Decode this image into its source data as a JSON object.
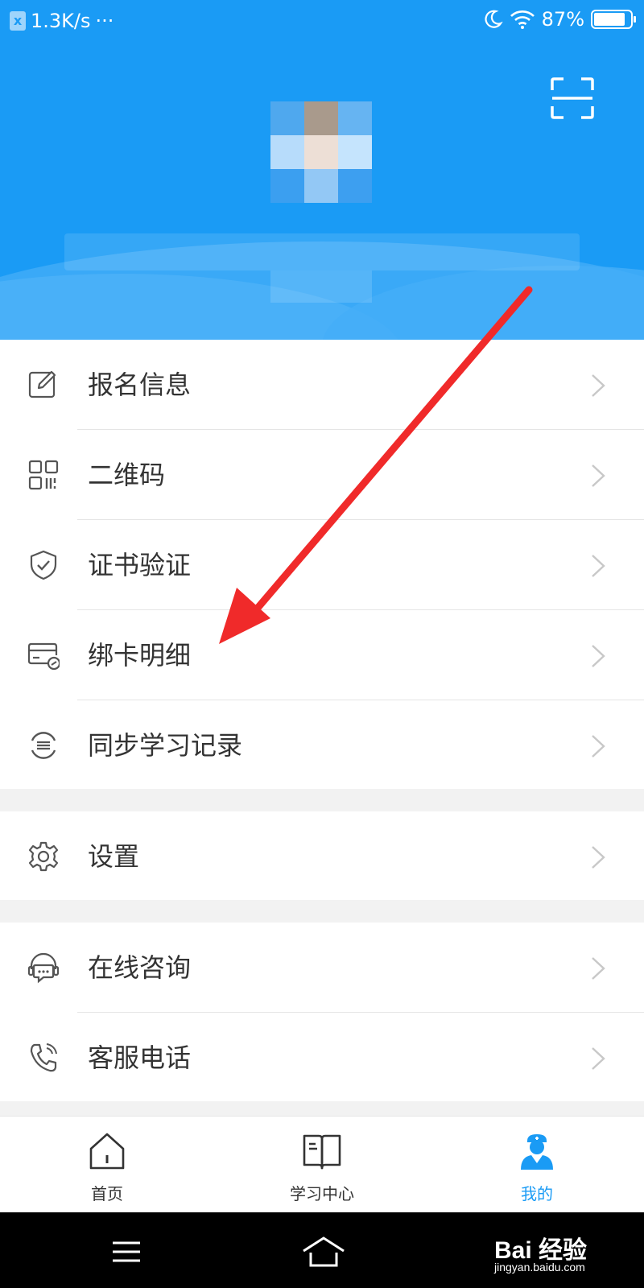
{
  "status_bar": {
    "speed": "1.3K/s",
    "more": "···",
    "battery": "87%",
    "battery_level": 0.87
  },
  "header": {
    "scan_icon": "scan-icon"
  },
  "menu": {
    "group1": [
      {
        "label": "报名信息",
        "icon": "edit-icon"
      },
      {
        "label": "二维码",
        "icon": "qrcode-icon"
      },
      {
        "label": "证书验证",
        "icon": "shield-check-icon"
      },
      {
        "label": "绑卡明细",
        "icon": "bank-card-icon"
      },
      {
        "label": "同步学习记录",
        "icon": "sync-icon"
      }
    ],
    "group2": [
      {
        "label": "设置",
        "icon": "gear-icon"
      }
    ],
    "group3": [
      {
        "label": "在线咨询",
        "icon": "chat-headset-icon"
      },
      {
        "label": "客服电话",
        "icon": "phone-icon"
      }
    ]
  },
  "tabbar": {
    "tabs": [
      {
        "label": "首页",
        "icon": "home-icon"
      },
      {
        "label": "学习中心",
        "icon": "book-icon"
      },
      {
        "label": "我的",
        "icon": "profile-icon",
        "active": true
      }
    ]
  },
  "watermark": {
    "main": "Bai 经验",
    "sub": "jingyan.baidu.com"
  },
  "colors": {
    "accent": "#1a9bf5",
    "annotation_arrow": "#f02a2a"
  }
}
